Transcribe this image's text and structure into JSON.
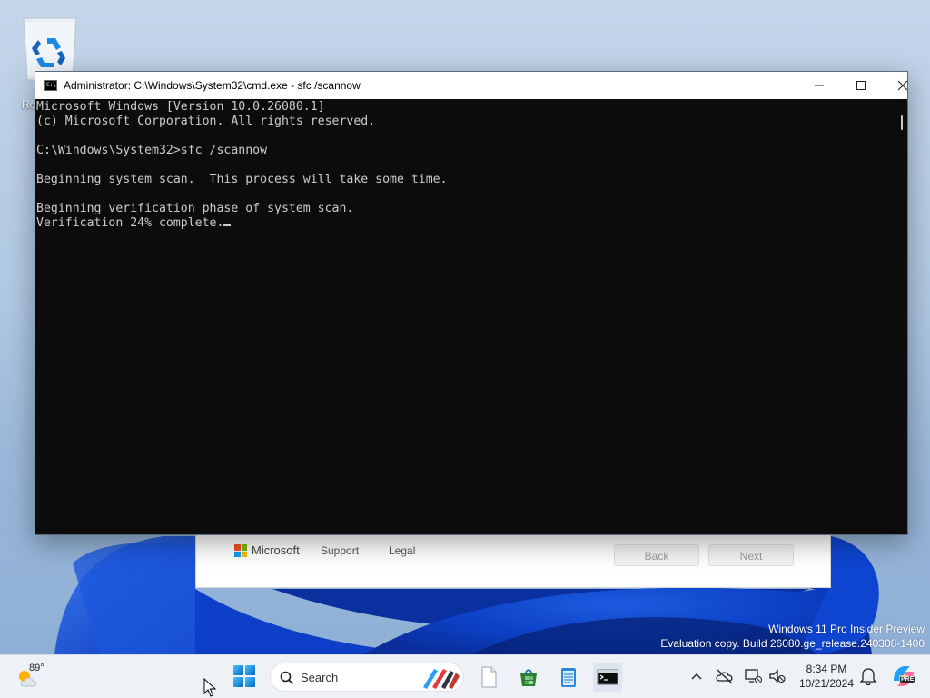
{
  "desktop": {
    "recycle_bin_label": "Re"
  },
  "watermark": {
    "line1": "Windows 11 Pro Insider Preview",
    "line2": "Evaluation copy. Build 26080.ge_release.240308-1400"
  },
  "setup_dialog": {
    "brand": "Microsoft",
    "links": [
      "Support",
      "Legal"
    ],
    "back_label": "Back",
    "next_label": "Next"
  },
  "cmd_window": {
    "title": "Administrator: C:\\Windows\\System32\\cmd.exe - sfc  /scannow",
    "lines": [
      "Microsoft Windows [Version 10.0.26080.1]",
      "(c) Microsoft Corporation. All rights reserved.",
      "",
      "C:\\Windows\\System32>sfc /scannow",
      "",
      "Beginning system scan.  This process will take some time.",
      "",
      "Beginning verification phase of system scan.",
      "Verification 24% complete."
    ],
    "background_color": "#0c0c0c",
    "text_color": "#cccccc"
  },
  "taskbar": {
    "weather_temp": "89°",
    "search_placeholder": "Search",
    "apps": [
      "file-explorer-icon",
      "store-icon",
      "notepad-icon",
      "terminal-icon"
    ],
    "clock_time": "8:34 PM",
    "clock_date": "10/21/2024",
    "copilot_badge": "PRE",
    "accent_color": "#0067c0"
  }
}
